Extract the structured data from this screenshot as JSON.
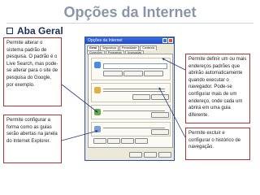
{
  "slide": {
    "title": "Opções da Internet",
    "bullet": "Aba Geral"
  },
  "notes": {
    "left_top": "Permite alterar o sistema padrão de pesquisa. O padrão é o Live Search, mas pode-se alterar para o site de pesquisa do Google, por exemplo.",
    "left_bottom": "Permite configurar a forma como as guias serão abertas na janela do Internet Explorer.",
    "right_top": "Permite definir um ou mais endereços padrões que abrirão automaticamente quando executar o navegador. Pode-se configurar mais de um endereço, onde cada um abrirá em uma guia diferente.",
    "right_bottom": "Permite excluir e configurar o histórico de navegação."
  },
  "dialog": {
    "title": "Opções da Internet",
    "tabs": [
      "Geral",
      "Segurança",
      "Privacidade",
      "Conteúdo",
      "Conexões",
      "Programas",
      "Avançadas"
    ]
  },
  "colors": {
    "title": "#8a96a8",
    "bullet": "#1e2f55",
    "note_border": "#b43232",
    "connector": "#1e3c78",
    "dialog_titlebar": "#1d4cc8"
  }
}
